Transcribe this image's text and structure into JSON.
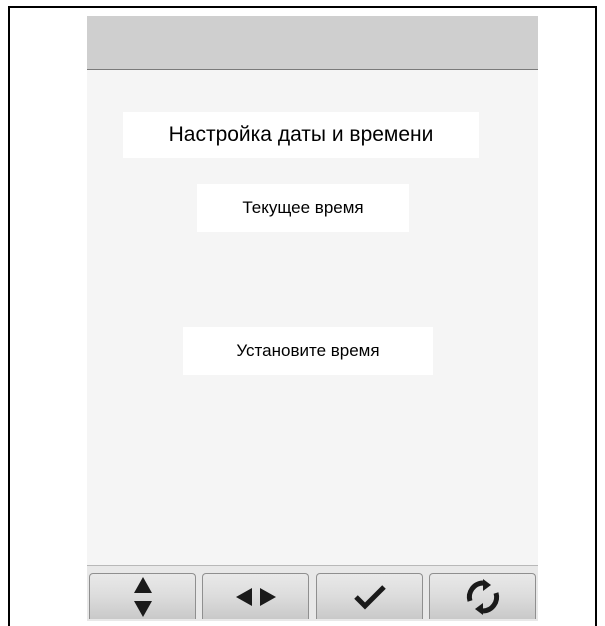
{
  "screen": {
    "title": "Настройка даты и времени",
    "current_time_label": "Текущее время",
    "set_time_label": "Установите время"
  },
  "buttons": [
    {
      "icon": "up-down-arrows-icon"
    },
    {
      "icon": "left-right-arrows-icon"
    },
    {
      "icon": "checkmark-icon"
    },
    {
      "icon": "refresh-icon"
    }
  ],
  "colors": {
    "header": "#cfcfcf",
    "screen_background": "#f5f5f5",
    "text_box": "#ffffff",
    "icon": "#1a1a1a"
  }
}
